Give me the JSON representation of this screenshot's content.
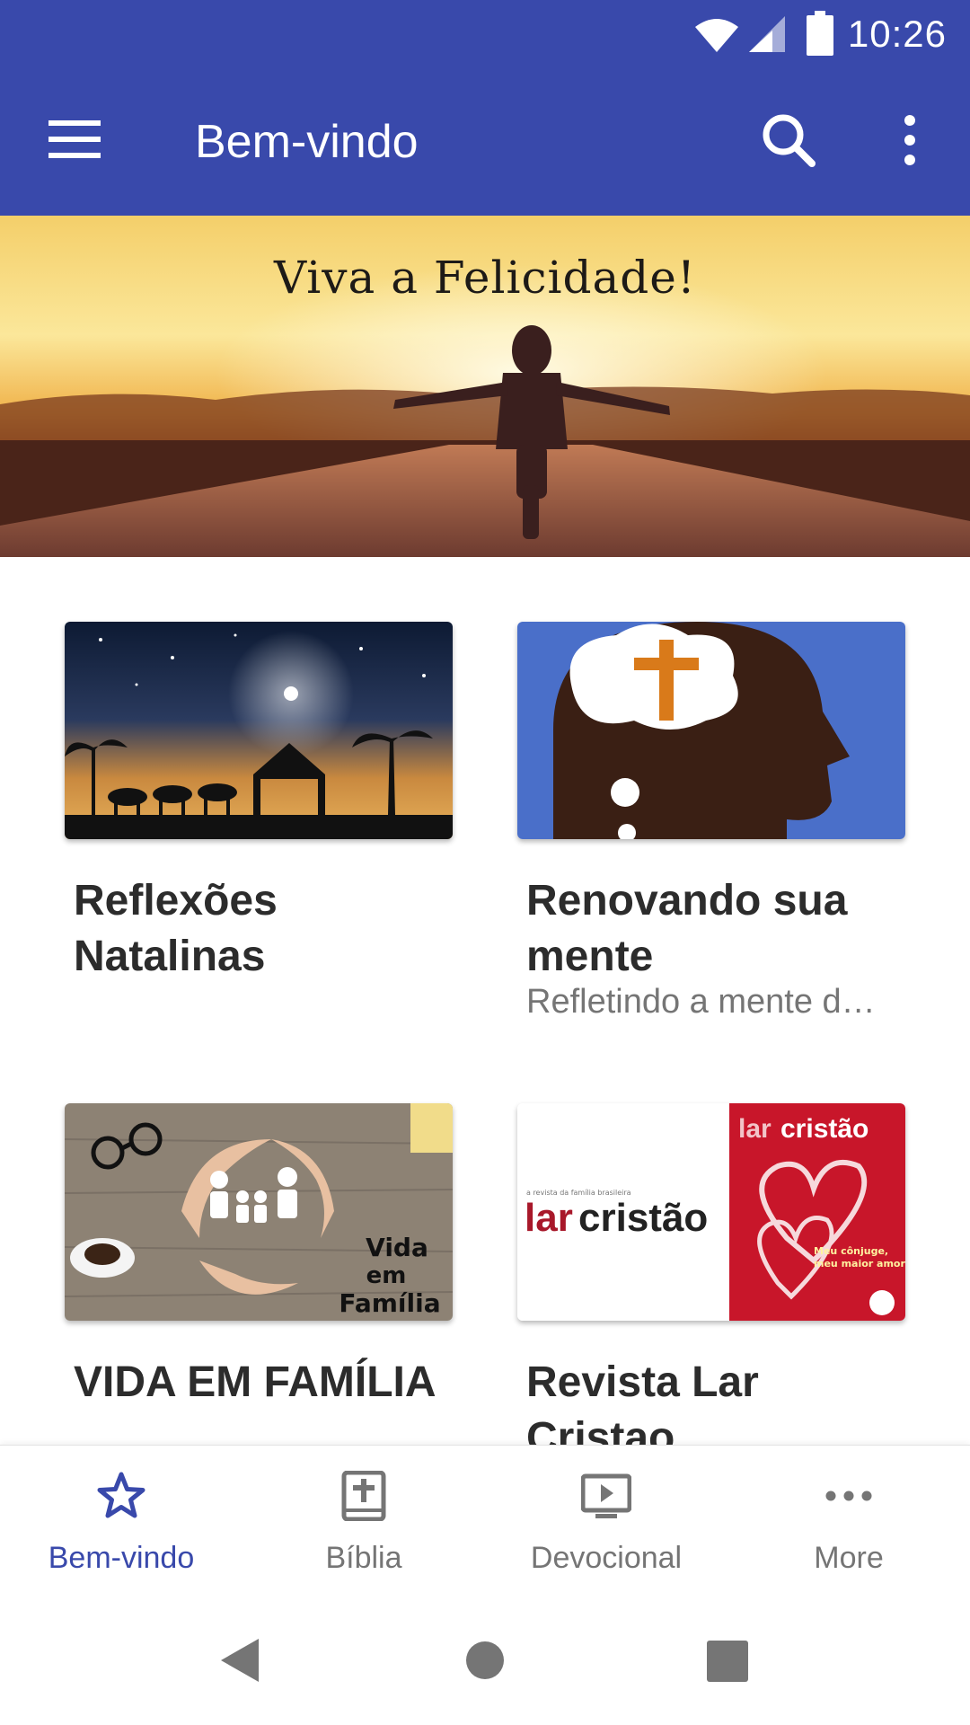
{
  "status_bar": {
    "time": "10:26",
    "icons": [
      "wifi-icon",
      "signal-icon",
      "battery-icon"
    ]
  },
  "app_bar": {
    "title": "Bem-vindo",
    "icons": [
      "menu-icon",
      "search-icon",
      "more-vert-icon"
    ]
  },
  "banner": {
    "title": "Viva a Felicidade!"
  },
  "cards": [
    {
      "title": "Reflexões Natalinas",
      "subtitle": ""
    },
    {
      "title": "Renovando sua mente",
      "subtitle": "Refletindo a mente d…"
    },
    {
      "title": "VIDA EM FAMÍLIA",
      "subtitle": ""
    },
    {
      "title": "Revista Lar Cristao",
      "subtitle": ""
    }
  ],
  "card_images": {
    "family_caption": "Vida em Família",
    "lar_brand_a": "lar",
    "lar_brand_b": "cristão",
    "lar_tagline": "a revista da família brasileira",
    "magazine_headline": "Meu cônjuge, meu maior amor"
  },
  "bottom_nav": {
    "items": [
      {
        "label": "Bem-vindo",
        "icon": "star-icon",
        "active": true
      },
      {
        "label": "Bíblia",
        "icon": "bible-icon",
        "active": false
      },
      {
        "label": "Devocional",
        "icon": "video-icon",
        "active": false
      },
      {
        "label": "More",
        "icon": "more-horiz-icon",
        "active": false
      }
    ]
  },
  "colors": {
    "primary": "#3949ab",
    "text_dark": "#2c2c2c",
    "text_muted": "#757575"
  }
}
